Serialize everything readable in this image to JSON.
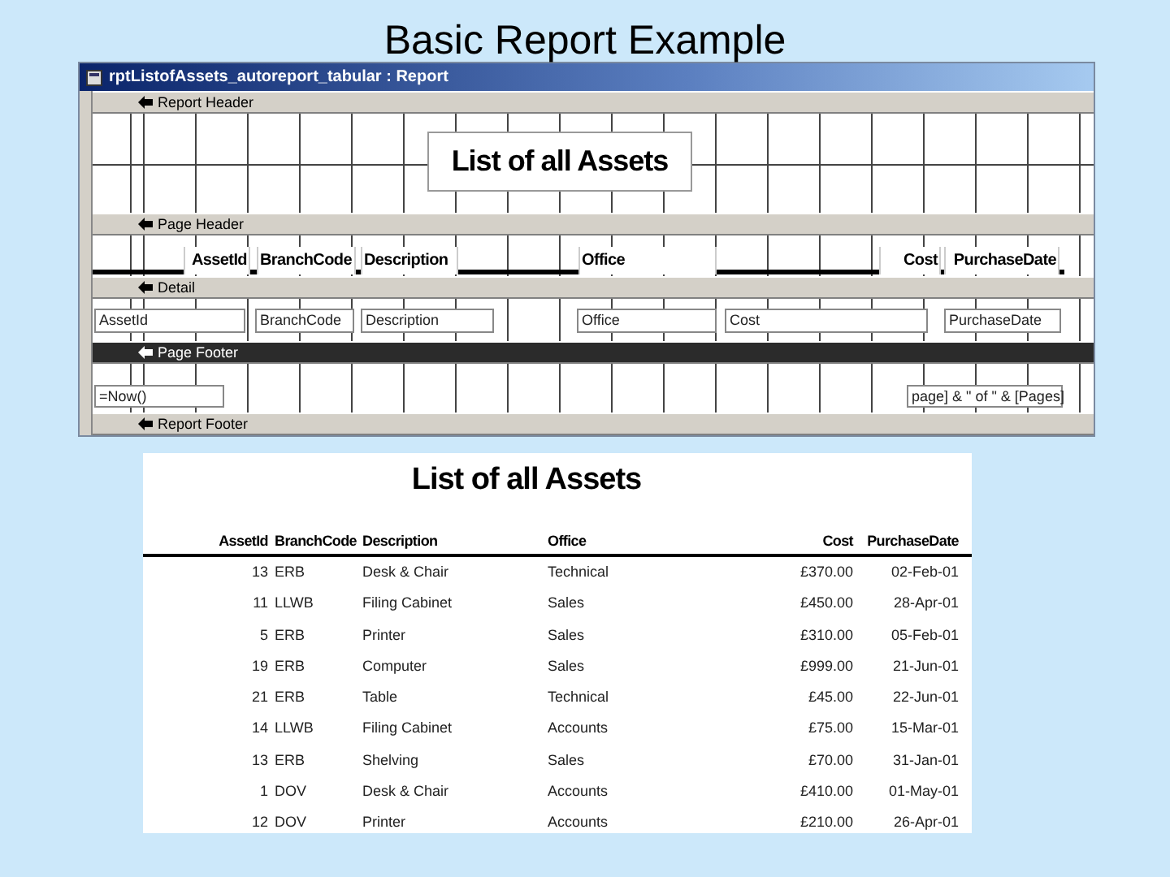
{
  "slide_title": "Basic Report Example",
  "design_window": {
    "title": "rptListofAssets_autoreport_tabular : Report",
    "sections": [
      {
        "label": "Report Header",
        "selected": false,
        "controls": [
          {
            "kind": "title",
            "text": "List of all Assets"
          }
        ]
      },
      {
        "label": "Page Header",
        "selected": false,
        "controls": [
          {
            "kind": "label",
            "text": "AssetId"
          },
          {
            "kind": "label",
            "text": "BranchCode"
          },
          {
            "kind": "label",
            "text": "Description"
          },
          {
            "kind": "label",
            "text": "Office"
          },
          {
            "kind": "label",
            "text": "Cost"
          },
          {
            "kind": "label",
            "text": "PurchaseDate"
          }
        ]
      },
      {
        "label": "Detail",
        "selected": false,
        "controls": [
          {
            "kind": "textbox",
            "text": "AssetId"
          },
          {
            "kind": "textbox",
            "text": "BranchCode"
          },
          {
            "kind": "textbox",
            "text": "Description"
          },
          {
            "kind": "textbox",
            "text": "Office"
          },
          {
            "kind": "textbox",
            "text": "Cost"
          },
          {
            "kind": "textbox",
            "text": "PurchaseDate"
          }
        ]
      },
      {
        "label": "Page Footer",
        "selected": true,
        "controls": [
          {
            "kind": "textbox",
            "text": "=Now()"
          },
          {
            "kind": "textbox",
            "text": "page] & \" of \" & [Pages]"
          }
        ]
      },
      {
        "label": "Report Footer",
        "selected": false
      }
    ]
  },
  "preview": {
    "title": "List of all Assets",
    "columns": [
      "AssetId",
      "BranchCode",
      "Description",
      "Office",
      "Cost",
      "PurchaseDate"
    ],
    "rows": [
      [
        "13",
        "ERB",
        "Desk & Chair",
        "Technical",
        "£370.00",
        "02-Feb-01"
      ],
      [
        "11",
        "LLWB",
        "Filing Cabinet",
        "Sales",
        "£450.00",
        "28-Apr-01"
      ],
      [
        "5",
        "ERB",
        "Printer",
        "Sales",
        "£310.00",
        "05-Feb-01"
      ],
      [
        "19",
        "ERB",
        "Computer",
        "Sales",
        "£999.00",
        "21-Jun-01"
      ],
      [
        "21",
        "ERB",
        "Table",
        "Technical",
        "£45.00",
        "22-Jun-01"
      ],
      [
        "14",
        "LLWB",
        "Filing Cabinet",
        "Accounts",
        "£75.00",
        "15-Mar-01"
      ],
      [
        "13",
        "ERB",
        "Shelving",
        "Sales",
        "£70.00",
        "31-Jan-01"
      ],
      [
        "1",
        "DOV",
        "Desk & Chair",
        "Accounts",
        "£410.00",
        "01-May-01"
      ],
      [
        "12",
        "DOV",
        "Printer",
        "Accounts",
        "£210.00",
        "26-Apr-01"
      ]
    ]
  }
}
